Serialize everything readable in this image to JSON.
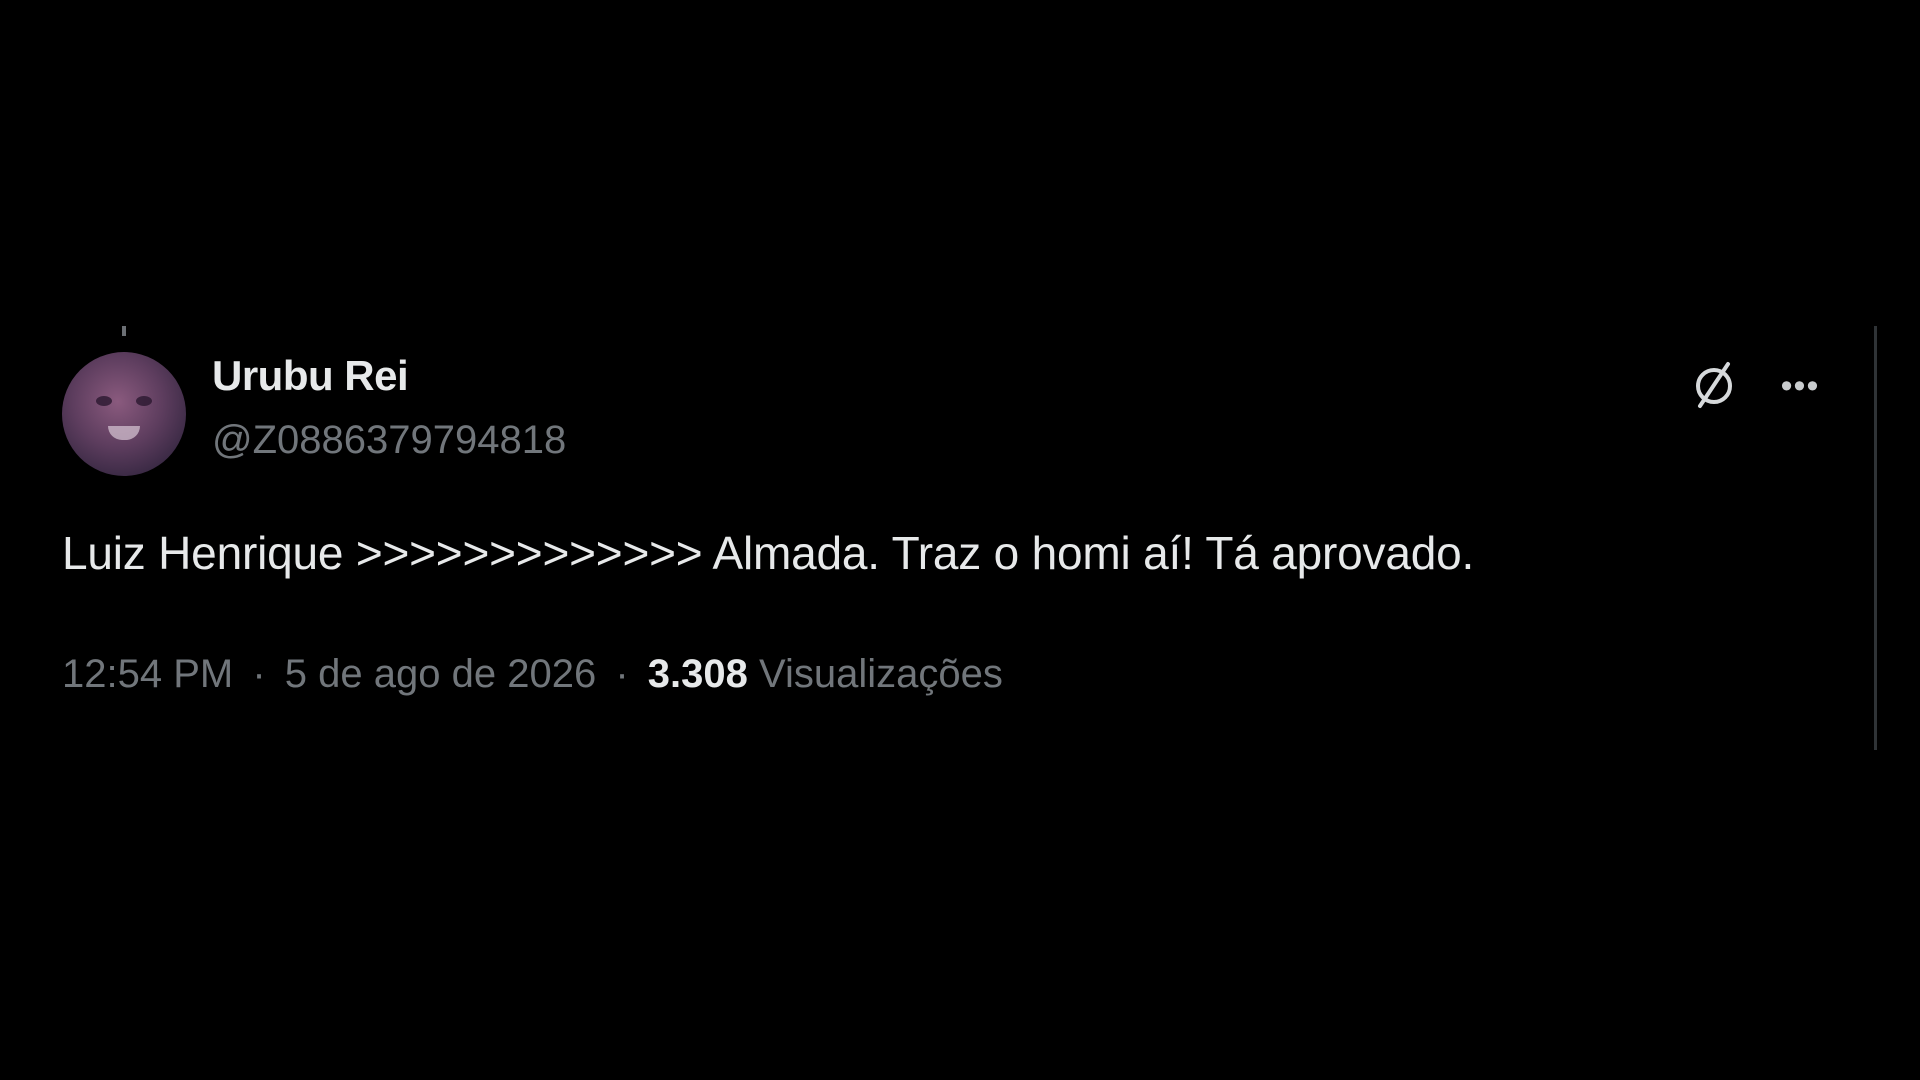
{
  "author": {
    "display_name": "Urubu Rei",
    "handle": "@Z0886379794818"
  },
  "icons": {
    "grok": "grok-icon",
    "more": "more-options-icon"
  },
  "tweet": {
    "text": "Luiz Henrique >>>>>>>>>>>>> Almada. Traz o homi aí! Tá aprovado."
  },
  "meta": {
    "time": "12:54 PM",
    "separator": "·",
    "date": "5 de ago de 2026",
    "views_count": "3.308",
    "views_label": "Visualizações"
  },
  "colors": {
    "background": "#000000",
    "primary_text": "#e7e9ea",
    "secondary_text": "#71767b"
  }
}
